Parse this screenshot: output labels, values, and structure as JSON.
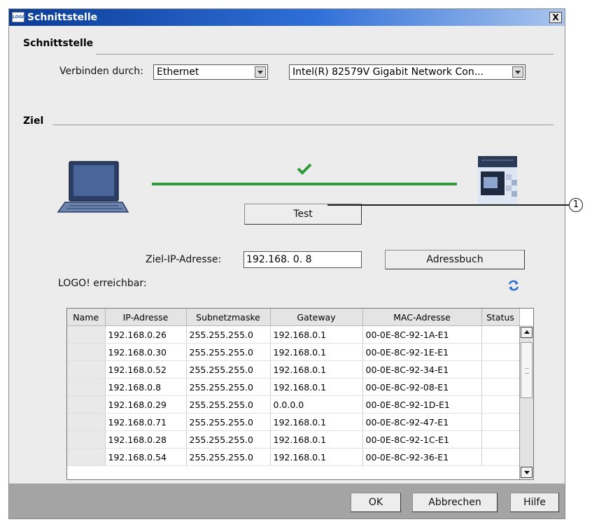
{
  "window": {
    "title": "Schnittstelle",
    "app_icon": "LOGO",
    "close_label": "X"
  },
  "interface": {
    "section_title": "Schnittstelle",
    "connect_label": "Verbinden durch:",
    "connect_value": "Ethernet",
    "adapter_value": "Intel(R) 82579V Gigabit Network Con..."
  },
  "target": {
    "section_title": "Ziel",
    "test_button": "Test",
    "ip_label": "Ziel-IP-Adresse:",
    "ip_value": "192.168.  0.  8",
    "addressbook_button": "Adressbuch",
    "reachable_label": "LOGO! erreichbar:",
    "connection_status_color": "#2e9a38"
  },
  "callout": {
    "number": "1"
  },
  "table": {
    "columns": [
      "Name",
      "IP-Adresse",
      "Subnetzmaske",
      "Gateway",
      "MAC-Adresse",
      "Status"
    ],
    "rows": [
      [
        "",
        "192.168.0.26",
        "255.255.255.0",
        "192.168.0.1",
        "00-0E-8C-92-1A-E1",
        ""
      ],
      [
        "",
        "192.168.0.30",
        "255.255.255.0",
        "192.168.0.1",
        "00-0E-8C-92-1E-E1",
        ""
      ],
      [
        "",
        "192.168.0.52",
        "255.255.255.0",
        "192.168.0.1",
        "00-0E-8C-92-34-E1",
        ""
      ],
      [
        "",
        "192.168.0.8",
        "255.255.255.0",
        "192.168.0.1",
        "00-0E-8C-92-08-E1",
        ""
      ],
      [
        "",
        "192.168.0.29",
        "255.255.255.0",
        "0.0.0.0",
        "00-0E-8C-92-1D-E1",
        ""
      ],
      [
        "",
        "192.168.0.71",
        "255.255.255.0",
        "192.168.0.1",
        "00-0E-8C-92-47-E1",
        ""
      ],
      [
        "",
        "192.168.0.28",
        "255.255.255.0",
        "192.168.0.1",
        "00-0E-8C-92-1C-E1",
        ""
      ],
      [
        "",
        "192.168.0.54",
        "255.255.255.0",
        "192.168.0.1",
        "00-0E-8C-92-36-E1",
        ""
      ]
    ]
  },
  "footer": {
    "ok": "OK",
    "cancel": "Abbrechen",
    "help": "Hilfe"
  },
  "icons": [
    "laptop-icon",
    "logo-device-icon",
    "checkmark-icon",
    "refresh-icon"
  ]
}
